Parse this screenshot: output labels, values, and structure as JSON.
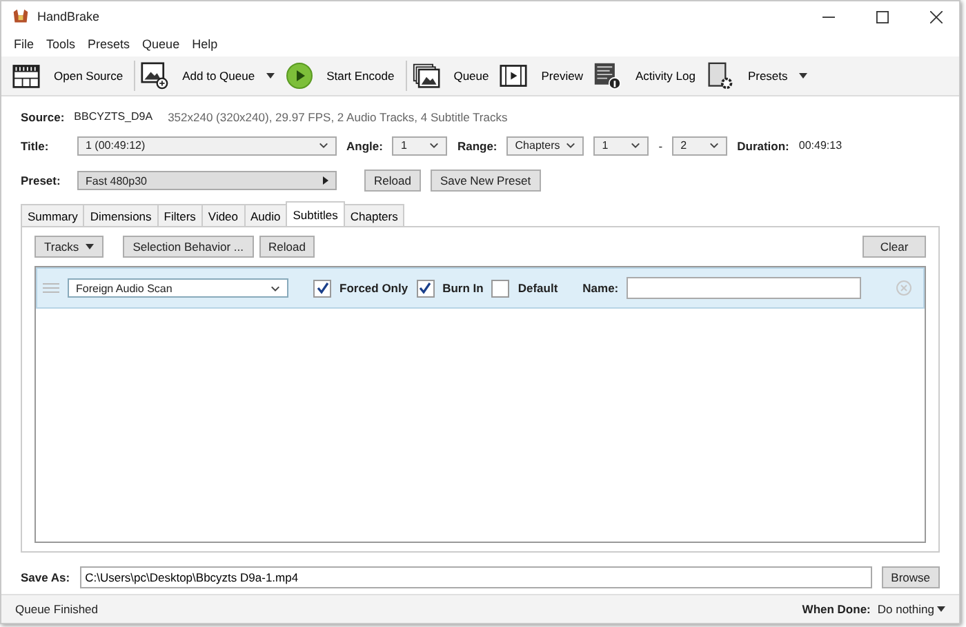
{
  "window": {
    "title": "HandBrake"
  },
  "menu": [
    "File",
    "Tools",
    "Presets",
    "Queue",
    "Help"
  ],
  "toolbar": [
    {
      "kind": "open",
      "label": "Open Source",
      "dropdown": false
    },
    {
      "kind": "add",
      "label": "Add to Queue",
      "dropdown": true
    },
    {
      "kind": "start",
      "label": "Start Encode",
      "dropdown": false
    },
    {
      "kind": "queue",
      "label": "Queue",
      "dropdown": false
    },
    {
      "kind": "preview",
      "label": "Preview",
      "dropdown": false
    },
    {
      "kind": "log",
      "label": "Activity Log",
      "dropdown": false
    },
    {
      "kind": "presets",
      "label": "Presets",
      "dropdown": true
    }
  ],
  "source": {
    "label": "Source:",
    "name": "BBCYZTS_D9A",
    "info": "352x240 (320x240), 29.97 FPS, 2 Audio Tracks, 4 Subtitle Tracks"
  },
  "title_row": {
    "title_label": "Title:",
    "title_value": "1 (00:49:12)",
    "angle_label": "Angle:",
    "angle_value": "1",
    "range_label": "Range:",
    "range_value": "Chapters",
    "range_start": "1",
    "range_sep": "-",
    "range_end": "2",
    "duration_label": "Duration:",
    "duration_value": "00:49:13"
  },
  "preset_row": {
    "label": "Preset:",
    "value": "Fast 480p30",
    "buttons": [
      "Reload",
      "Save New Preset"
    ]
  },
  "tabs": [
    {
      "label": "Summary",
      "selected": false
    },
    {
      "label": "Dimensions",
      "selected": false
    },
    {
      "label": "Filters",
      "selected": false
    },
    {
      "label": "Video",
      "selected": false
    },
    {
      "label": "Audio",
      "selected": false
    },
    {
      "label": "Subtitles",
      "selected": true
    },
    {
      "label": "Chapters",
      "selected": false
    }
  ],
  "subtitles": {
    "tracks_button": "Tracks",
    "selection_button": "Selection Behavior ...",
    "reload_button": "Reload",
    "clear_button": "Clear",
    "rows": [
      {
        "track": "Foreign Audio Scan",
        "forced_only": true,
        "forced_label": "Forced Only",
        "burn_in": true,
        "burn_label": "Burn In",
        "default": false,
        "default_label": "Default",
        "name_label": "Name:",
        "name": ""
      }
    ]
  },
  "save_as": {
    "label": "Save As:",
    "value": "C:\\Users\\pc\\Desktop\\Bbcyzts D9a-1.mp4",
    "button": "Browse"
  },
  "status_bar": {
    "text": "Queue Finished",
    "when_done_label": "When Done:",
    "when_done_value": "Do nothing"
  }
}
